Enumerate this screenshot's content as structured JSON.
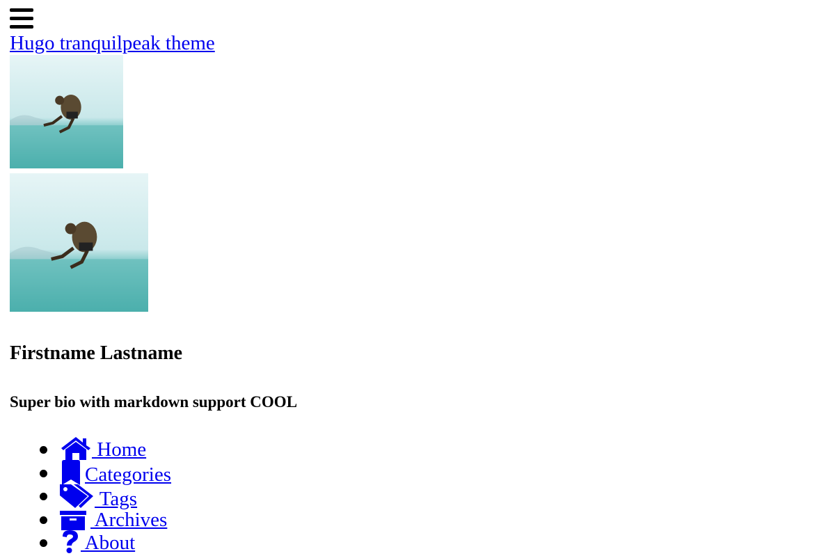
{
  "header": {
    "menu_icon": "bars-icon",
    "site_title": "Hugo tranquilpeak theme"
  },
  "author": {
    "name": "Firstname Lastname",
    "bio": "Super bio with markdown support COOL",
    "avatar_small_alt": "Author's picture",
    "avatar_large_alt": "Author's picture"
  },
  "nav": {
    "items": [
      {
        "label": " Home",
        "icon": "home-icon"
      },
      {
        "label": "Categories",
        "icon": "bookmark-icon"
      },
      {
        "label": " Tags",
        "icon": "tags-icon"
      },
      {
        "label": " Archives",
        "icon": "archive-icon"
      },
      {
        "label": " About",
        "icon": "question-icon"
      }
    ]
  },
  "colors": {
    "link": "#0000ee",
    "text": "#000000",
    "background": "#ffffff"
  }
}
